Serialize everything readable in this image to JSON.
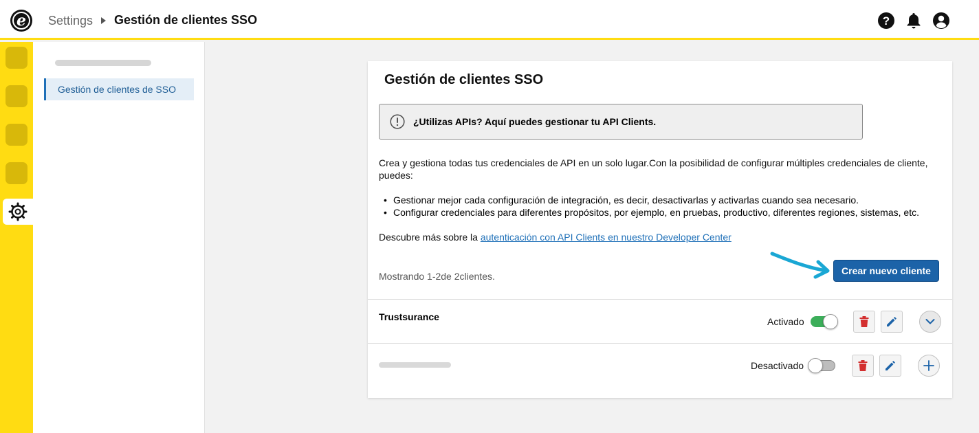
{
  "header": {
    "logo_letter": "e",
    "breadcrumb": {
      "root": "Settings",
      "current": "Gestión de clientes SSO"
    },
    "icons": [
      "help-icon",
      "bell-icon",
      "user-icon"
    ]
  },
  "sidebar": {
    "rail_icons": [
      "app-icon",
      "app-icon",
      "app-icon",
      "app-icon",
      "gear-icon"
    ],
    "nav_items": [
      {
        "label": "Gestión de clientes de SSO",
        "active": true
      }
    ]
  },
  "main": {
    "title": "Gestión de clientes SSO",
    "notice": {
      "icon": "exclamation-circle-icon",
      "text": "¿Utilizas APIs? Aquí puedes gestionar tu API Clients."
    },
    "intro": "Crea y gestiona todas tus credenciales de API en un solo lugar.Con la posibilidad de configurar múltiples credenciales de cliente, puedes:",
    "bullets": [
      "Gestionar mejor cada configuración de integración, es decir, desactivarlas y activarlas cuando sea necesario.",
      "Configurar credenciales para diferentes propósitos, por ejemplo, en pruebas, productivo, diferentes regiones, sistemas, etc."
    ],
    "learn_more": {
      "prefix": "Descubre más sobre la ",
      "link_text": "autenticación con API Clients en nuestro Developer Center"
    },
    "showing": "Mostrando 1-2de 2clientes.",
    "create_button": "Crear nuevo cliente",
    "clients": [
      {
        "name": "Trustsurance",
        "status": "Activado",
        "enabled": true,
        "expand": "chevron-down-icon"
      },
      {
        "name": "",
        "status": "Desactivado",
        "enabled": false,
        "expand": "plus-icon"
      }
    ]
  },
  "colors": {
    "brand_yellow": "#ffdc12",
    "primary_blue": "#1c63a8",
    "toggle_on": "#3cae5a",
    "delete_red": "#d32f2f",
    "arrow_cyan": "#1aa7d4"
  }
}
